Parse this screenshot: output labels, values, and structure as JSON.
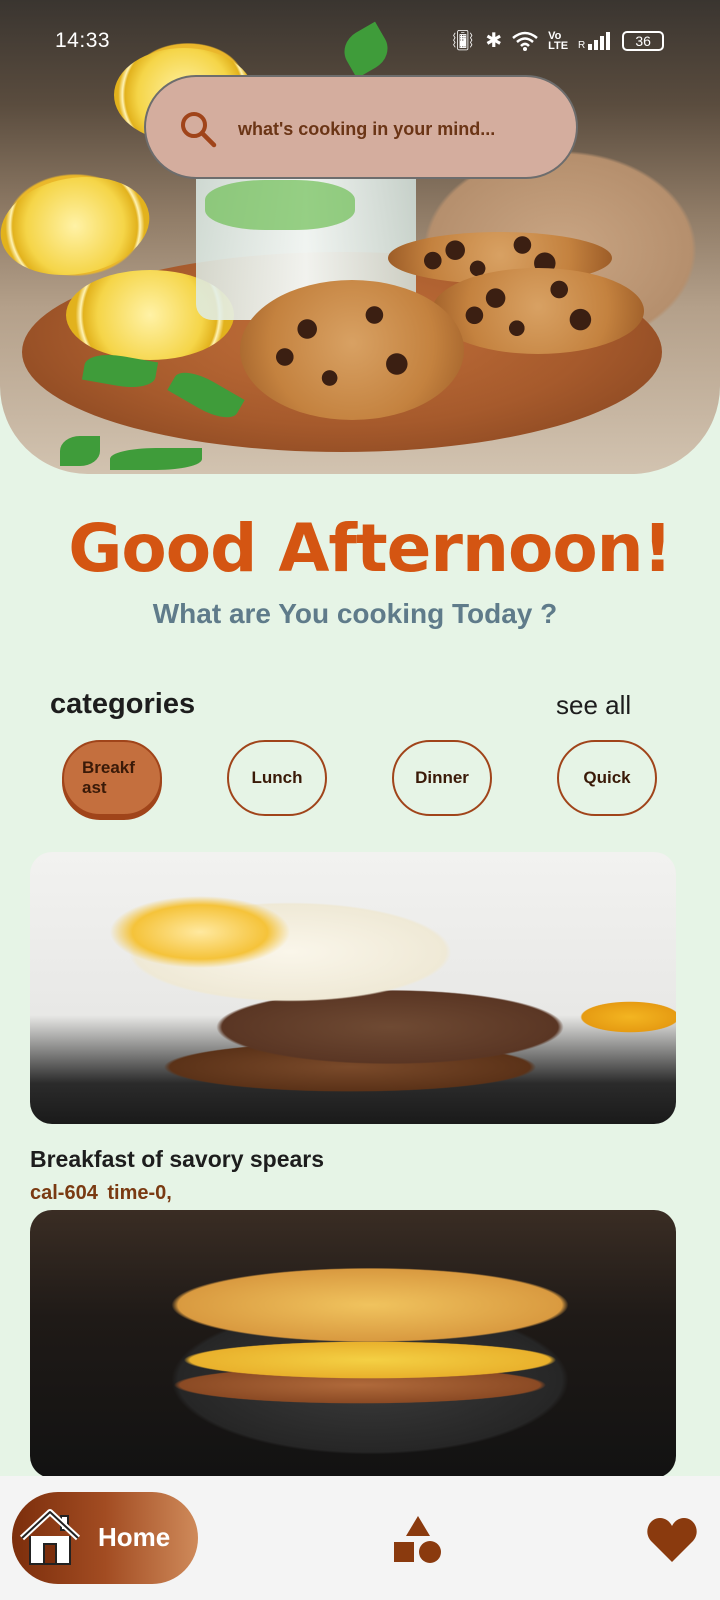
{
  "status_bar": {
    "time": "14:33",
    "battery": "36",
    "icons": [
      "vibrate-icon",
      "bluetooth-icon",
      "wifi-icon",
      "volte-icon",
      "signal-icon",
      "battery-icon"
    ]
  },
  "search": {
    "placeholder": "what's cooking in your mind...",
    "icon": "search-icon"
  },
  "greeting": {
    "title": "Good Afternoon!",
    "subtitle": "What are You cooking Today ?"
  },
  "categories": {
    "title": "categories",
    "see_all": "see all",
    "chips": [
      {
        "label": "Breakf ast",
        "active": true
      },
      {
        "label": "Lunch",
        "active": false
      },
      {
        "label": "Dinner",
        "active": false
      },
      {
        "label": "Quick",
        "active": false
      }
    ]
  },
  "recipes": [
    {
      "title": "Breakfast of savory spears",
      "meta": "cal-604 time-0,"
    }
  ],
  "bottom_nav": {
    "home_label": "Home",
    "items": [
      "home-icon",
      "categories-icon",
      "heart-icon"
    ]
  },
  "colors": {
    "background": "#e6f4e6",
    "accent": "#d45512",
    "subtitle": "#5f7b8a",
    "chip_active": "#c46f3e",
    "search_bg": "#d4ad9e",
    "nav_brown": "#7c2e0c"
  }
}
